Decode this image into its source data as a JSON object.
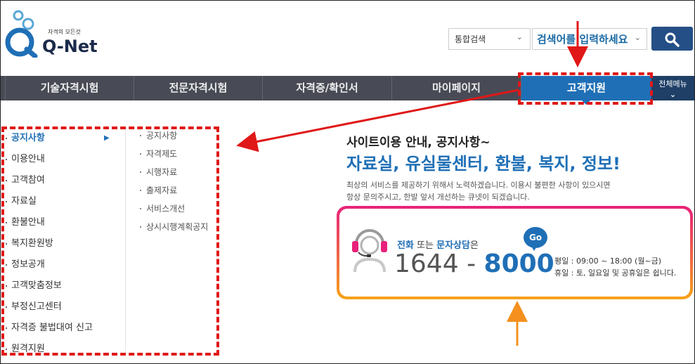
{
  "logo": {
    "tagline": "자격의 모든것",
    "brand": "Q-Net"
  },
  "search": {
    "category": "통합검색",
    "placeholder": "검색어를 입력하세요",
    "button_icon": "search-icon"
  },
  "nav": {
    "items": [
      {
        "label": "기술자격시험"
      },
      {
        "label": "전문자격시험"
      },
      {
        "label": "자격증/확인서"
      },
      {
        "label": "마이페이지"
      },
      {
        "label": "고객지원"
      }
    ],
    "all_menu": "전체메뉴"
  },
  "sidebar": {
    "items": [
      {
        "label": "공지사항"
      },
      {
        "label": "이용안내"
      },
      {
        "label": "고객참여"
      },
      {
        "label": "자료실"
      },
      {
        "label": "환불안내"
      },
      {
        "label": "복지환원방"
      },
      {
        "label": "정보공개"
      },
      {
        "label": "고객맞춤정보"
      },
      {
        "label": "부정신고센터"
      },
      {
        "label": "자격증 불법대여 신고"
      },
      {
        "label": "원격지원"
      }
    ],
    "subitems": [
      {
        "label": "공지사항"
      },
      {
        "label": "자격제도"
      },
      {
        "label": "시행자료"
      },
      {
        "label": "출제자료"
      },
      {
        "label": "서비스개선"
      },
      {
        "label": "상시시행계획공지"
      }
    ]
  },
  "guide": {
    "line1": "사이트이용 안내, 공지사항~",
    "line2": "자료실, 유실물센터, 환불, 복지, 정보!",
    "desc1": "최상의 서비스를 제공하기 위해서 노력하겠습니다. 이용시 불편한 사항이 있으시면",
    "desc2": "항상 문의주시고, 한발 앞서 개선하는 큐넷이 되겠습니다."
  },
  "contact": {
    "phone_word": "전화",
    "or_word": "또는",
    "chat_word": "문자상담",
    "suffix": "은",
    "go_label": "Go",
    "phone_part1": "1644",
    "phone_sep": "-",
    "phone_part2": "8000",
    "weekday": "평일 : 09:00 ~ 18:00 (월~금)",
    "holiday": "휴일 : 토, 일요일 및 공휴일은 쉽니다."
  },
  "colors": {
    "accent": "#1f6fb6",
    "nav_bg": "#484a55",
    "annotation": "#e01818"
  }
}
